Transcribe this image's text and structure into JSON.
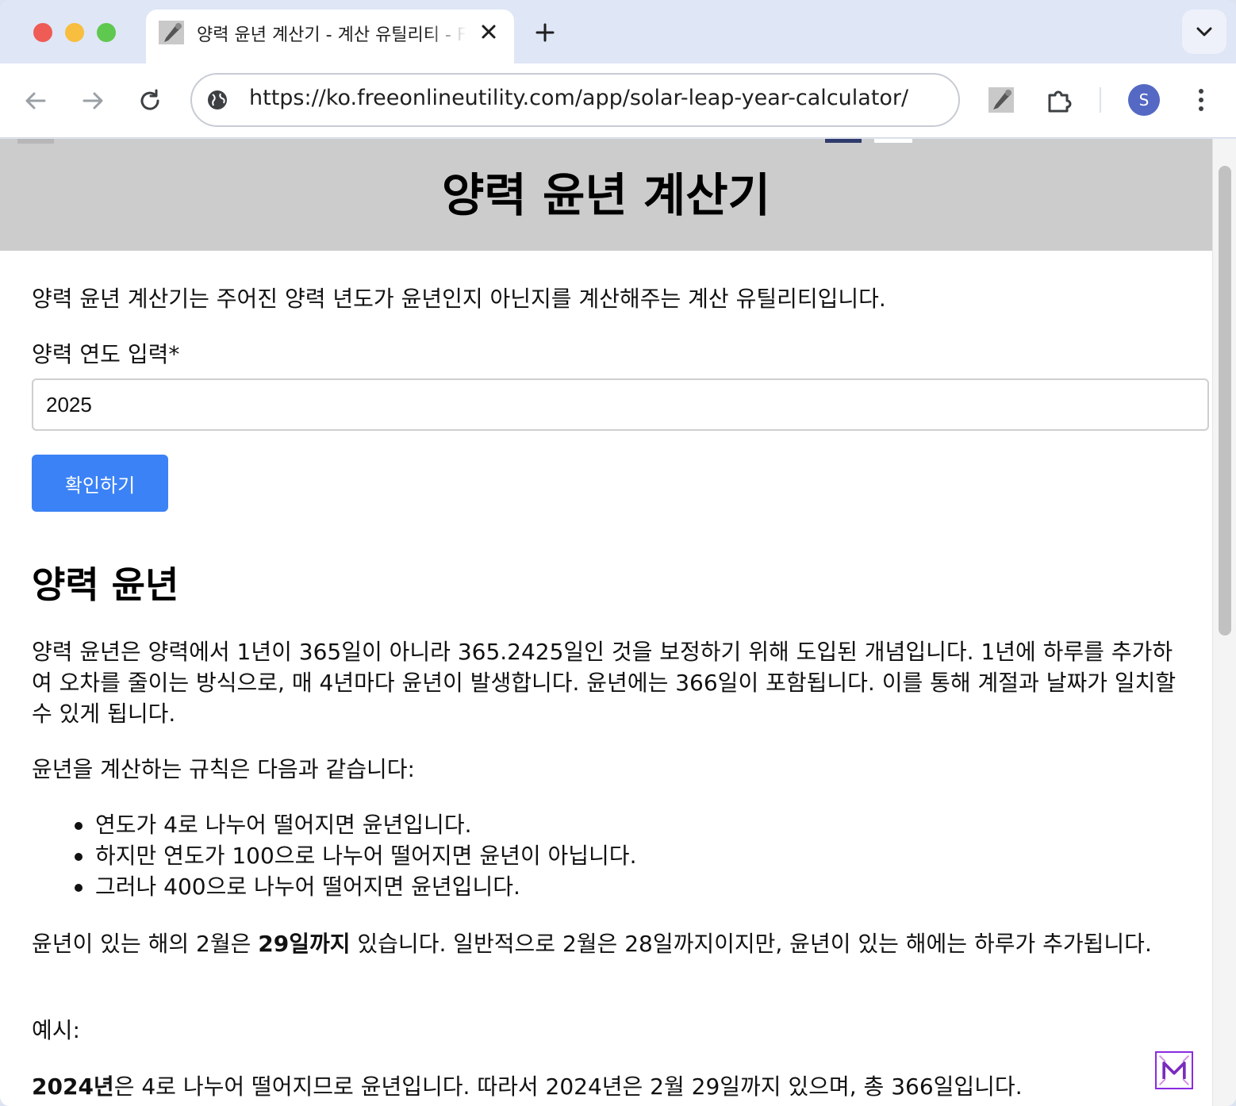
{
  "browser": {
    "tab_title": "양력 윤년 계산기 - 계산 유틸리티 - Free Online Utility",
    "url": "https://ko.freeonlineutility.com/app/solar-leap-year-calculator/",
    "avatar_initial": "S"
  },
  "page": {
    "title": "양력 윤년 계산기",
    "intro": "양력 윤년 계산기는 주어진 양력 년도가 윤년인지 아닌지를 계산해주는 계산 유틸리티입니다.",
    "year_label": "양력 연도 입력*",
    "year_value": "2025",
    "check_button": "확인하기",
    "section_title": "양력 윤년",
    "paragraph1": "양력 윤년은 양력에서 1년이 365일이 아니라 365.2425일인 것을 보정하기 위해 도입된 개념입니다. 1년에 하루를 추가하여 오차를 줄이는 방식으로, 매 4년마다 윤년이 발생합니다. 윤년에는 366일이 포함됩니다. 이를 통해 계절과 날짜가 일치할 수 있게 됩니다.",
    "paragraph2": "윤년을 계산하는 규칙은 다음과 같습니다:",
    "rules": [
      "연도가 4로 나누어 떨어지면 윤년입니다.",
      "하지만 연도가 100으로 나누어 떨어지면 윤년이 아닙니다.",
      "그러나 400으로 나누어 떨어지면 윤년입니다."
    ],
    "paragraph3_pre": "윤년이 있는 해의 2월은 ",
    "paragraph3_bold": "29일까지",
    "paragraph3_post": " 있습니다. 일반적으로 2월은 28일까지이지만, 윤년이 있는 해에는 하루가 추가됩니다.",
    "example_label": "예시:",
    "example_bold": "2024년",
    "example_text": "은 4로 나누어 떨어지므로 윤년입니다. 따라서 2024년은 2월 29일까지 있으며, 총 366일입니다."
  },
  "colors": {
    "header_band": "#cccccc",
    "button": "#3b82f6",
    "tab_strip": "#dfe6f6",
    "avatar": "#5468c4"
  }
}
